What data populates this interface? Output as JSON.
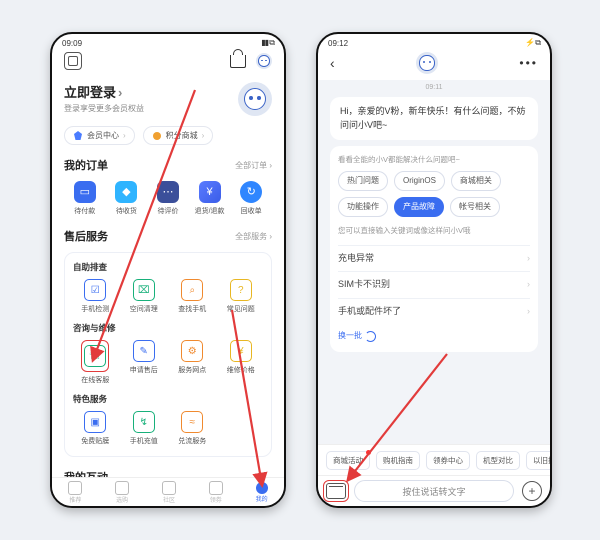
{
  "left": {
    "status_time": "09:09",
    "login_title": "立即登录",
    "login_sub": "登录享受更多会员权益",
    "pills": {
      "member": "会员中心",
      "points": "积分商城"
    },
    "orders": {
      "title": "我的订单",
      "more": "全部订单",
      "items": [
        "待付款",
        "待收货",
        "待评价",
        "退货/退款",
        "回收单"
      ]
    },
    "aftersale": {
      "title": "售后服务",
      "more": "全部服务",
      "sub1": "自助排查",
      "sub1_items": [
        "手机检测",
        "空间清理",
        "查找手机",
        "常见问题"
      ],
      "sub2": "咨询与维修",
      "sub2_items": [
        "在线客服",
        "申请售后",
        "服务网点",
        "维修价格"
      ],
      "sub3": "特色服务",
      "sub3_items": [
        "免费贴膜",
        "手机充值",
        "兑流服务"
      ]
    },
    "interact": {
      "title": "我的互动"
    },
    "tabs": [
      "推荐",
      "选购",
      "社区",
      "领券",
      "我的"
    ]
  },
  "right": {
    "status_time": "09:12",
    "timestamp": "09:11",
    "greeting": "Hi，亲爱的V粉，新年快乐！有什么问题，不妨问问小V吧~",
    "panel_hint": "看看全能的小V都能解决什么问题吧~",
    "chips": [
      "热门问题",
      "OriginOS",
      "商城相关",
      "功能操作",
      "产品故障",
      "帐号相关"
    ],
    "active_chip": 4,
    "qa_hint": "您可以直接输入关键词或像这样问小V哦",
    "qa": [
      "充电异常",
      "SIM卡不识别",
      "手机或配件坏了"
    ],
    "swap": "换一批",
    "bottom_pills": [
      "商城活动",
      "购机指南",
      "领券中心",
      "机型对比",
      "以旧换新"
    ],
    "voice_placeholder": "按住说话转文字"
  }
}
